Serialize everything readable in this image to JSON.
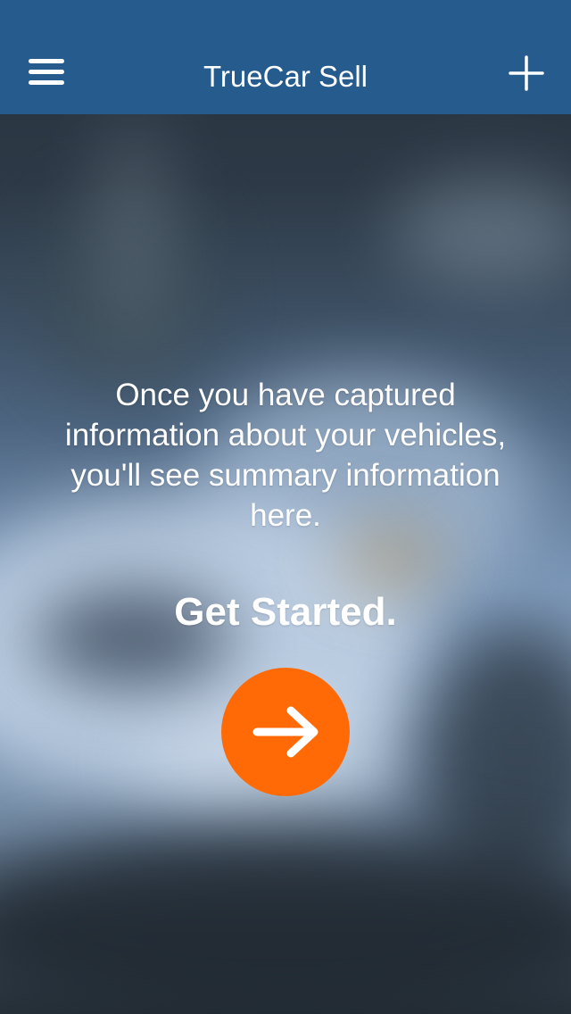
{
  "header": {
    "title": "TrueCar Sell",
    "menu_icon": "hamburger-menu-icon",
    "add_icon": "plus-icon"
  },
  "empty_state": {
    "message": "Once you have captured information about your vehicles, you'll see summary information here.",
    "cta_text": "Get Started.",
    "cta_icon": "arrow-right-icon"
  },
  "colors": {
    "navbar": "#255b8d",
    "accent": "#ff6a07",
    "text": "#ffffff"
  }
}
